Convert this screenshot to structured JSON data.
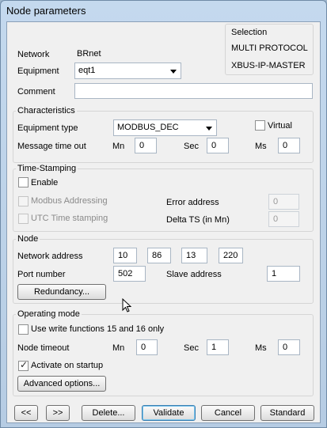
{
  "window": {
    "title": "Node parameters"
  },
  "selection": {
    "title": "Selection",
    "line1": "MULTI PROTOCOL",
    "line2": "XBUS-IP-MASTER"
  },
  "general": {
    "network_label": "Network",
    "network_value": "BRnet",
    "equipment_label": "Equipment",
    "equipment_value": "eqt1",
    "comment_label": "Comment",
    "comment_value": ""
  },
  "characteristics": {
    "legend": "Characteristics",
    "equipment_type_label": "Equipment type",
    "equipment_type_value": "MODBUS_DEC",
    "virtual_label": "Virtual",
    "virtual_checked": false,
    "timeout_label": "Message time out",
    "mn_label": "Mn",
    "mn_value": "0",
    "sec_label": "Sec",
    "sec_value": "0",
    "ms_label": "Ms",
    "ms_value": "0"
  },
  "timestamping": {
    "legend": "Time-Stamping",
    "enable_label": "Enable",
    "modbus_label": "Modbus Addressing",
    "utc_label": "UTC Time stamping",
    "error_address_label": "Error address",
    "error_address_value": "0",
    "delta_ts_label": "Delta TS (in Mn)",
    "delta_ts_value": "0"
  },
  "node": {
    "legend": "Node",
    "network_address_label": "Network address",
    "ip": [
      "10",
      "86",
      "13",
      "220"
    ],
    "port_label": "Port number",
    "port_value": "502",
    "slave_label": "Slave address",
    "slave_value": "1",
    "redundancy_button": "Redundancy..."
  },
  "operating": {
    "legend": "Operating mode",
    "write_functions_label": "Use write functions 15 and 16 only",
    "timeout_label": "Node timeout",
    "mn_label": "Mn",
    "mn_value": "0",
    "sec_label": "Sec",
    "sec_value": "1",
    "ms_label": "Ms",
    "ms_value": "0",
    "activate_label": "Activate on startup",
    "advanced_button": "Advanced options..."
  },
  "buttons": {
    "prev": "<<",
    "next": ">>",
    "delete": "Delete...",
    "validate": "Validate",
    "cancel": "Cancel",
    "standard": "Standard"
  }
}
